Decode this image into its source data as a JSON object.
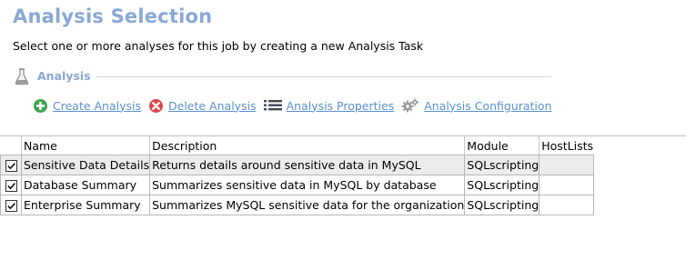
{
  "page": {
    "title": "Analysis Selection",
    "subtitle": "Select one or more analyses for this job by creating a new Analysis Task"
  },
  "section": {
    "title": "Analysis",
    "icon": "flask-icon"
  },
  "toolbar": {
    "create_label": "Create Analysis",
    "delete_label": "Delete Analysis",
    "properties_label": "Analysis Properties",
    "configuration_label": "Analysis Configuration"
  },
  "colors": {
    "title": "#8aa8d8",
    "link": "#5b8fd4",
    "create_icon": "#3ea44b",
    "delete_icon": "#e0464b"
  },
  "grid": {
    "columns": [
      "Name",
      "Description",
      "Module",
      "HostLists"
    ],
    "rows": [
      {
        "checked": true,
        "name": "Sensitive Data Details",
        "description": "Returns details around sensitive data in MySQL",
        "module": "SQLscripting",
        "hostlists": ""
      },
      {
        "checked": true,
        "name": "Database Summary",
        "description": "Summarizes sensitive data in MySQL by database",
        "module": "SQLscripting",
        "hostlists": ""
      },
      {
        "checked": true,
        "name": "Enterprise Summary",
        "description": "Summarizes MySQL sensitive data for the organization",
        "module": "SQLscripting",
        "hostlists": ""
      }
    ]
  }
}
